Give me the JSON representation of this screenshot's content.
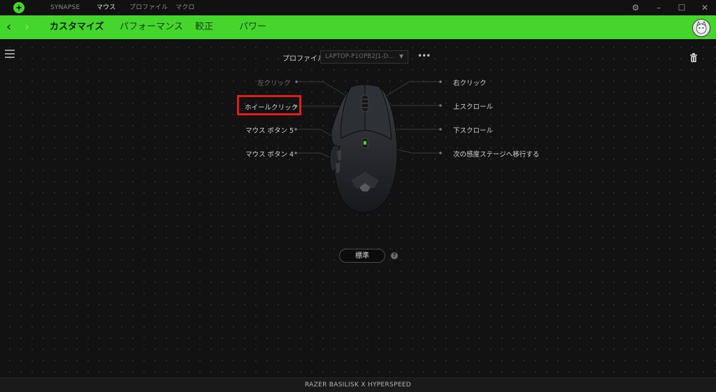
{
  "app": {
    "nav": [
      "SYNAPSE",
      "マウス",
      "プロファイル",
      "マクロ"
    ],
    "active_nav": "マウス"
  },
  "window_controls": {
    "settings": "⚙",
    "minimize": "–",
    "maximize": "☐",
    "close": "✕"
  },
  "green_bar": {
    "back": "‹",
    "forward": "›",
    "tabs": [
      "カスタマイズ",
      "パフォーマンス",
      "較正",
      "パワー"
    ],
    "active_tab": "カスタマイズ"
  },
  "profile": {
    "label": "プロファイル",
    "value": "LAPTOP-P1OPB2J1-D...",
    "more": "•••"
  },
  "buttons": {
    "left_click": "左クリック",
    "wheel_click": "ホイールクリック",
    "mouse_button_5": "マウス ボタン 5",
    "mouse_button_4": "マウス ボタン 4",
    "right_click": "右クリック",
    "scroll_up": "上スクロール",
    "scroll_down": "下スクロール",
    "next_stage": "次の感度ステージへ移行する"
  },
  "mode": {
    "label": "標準",
    "help": "?"
  },
  "device": {
    "name": "RAZER BASILISK X HYPERSPEED"
  },
  "icons": [
    "razer-logo-icon",
    "gear-icon",
    "hamburger-menu-icon",
    "trash-icon",
    "help-icon",
    "chevron-down-icon"
  ],
  "colors": {
    "accent": "#44d62c",
    "highlight": "#e01e1e",
    "background": "#121212"
  }
}
